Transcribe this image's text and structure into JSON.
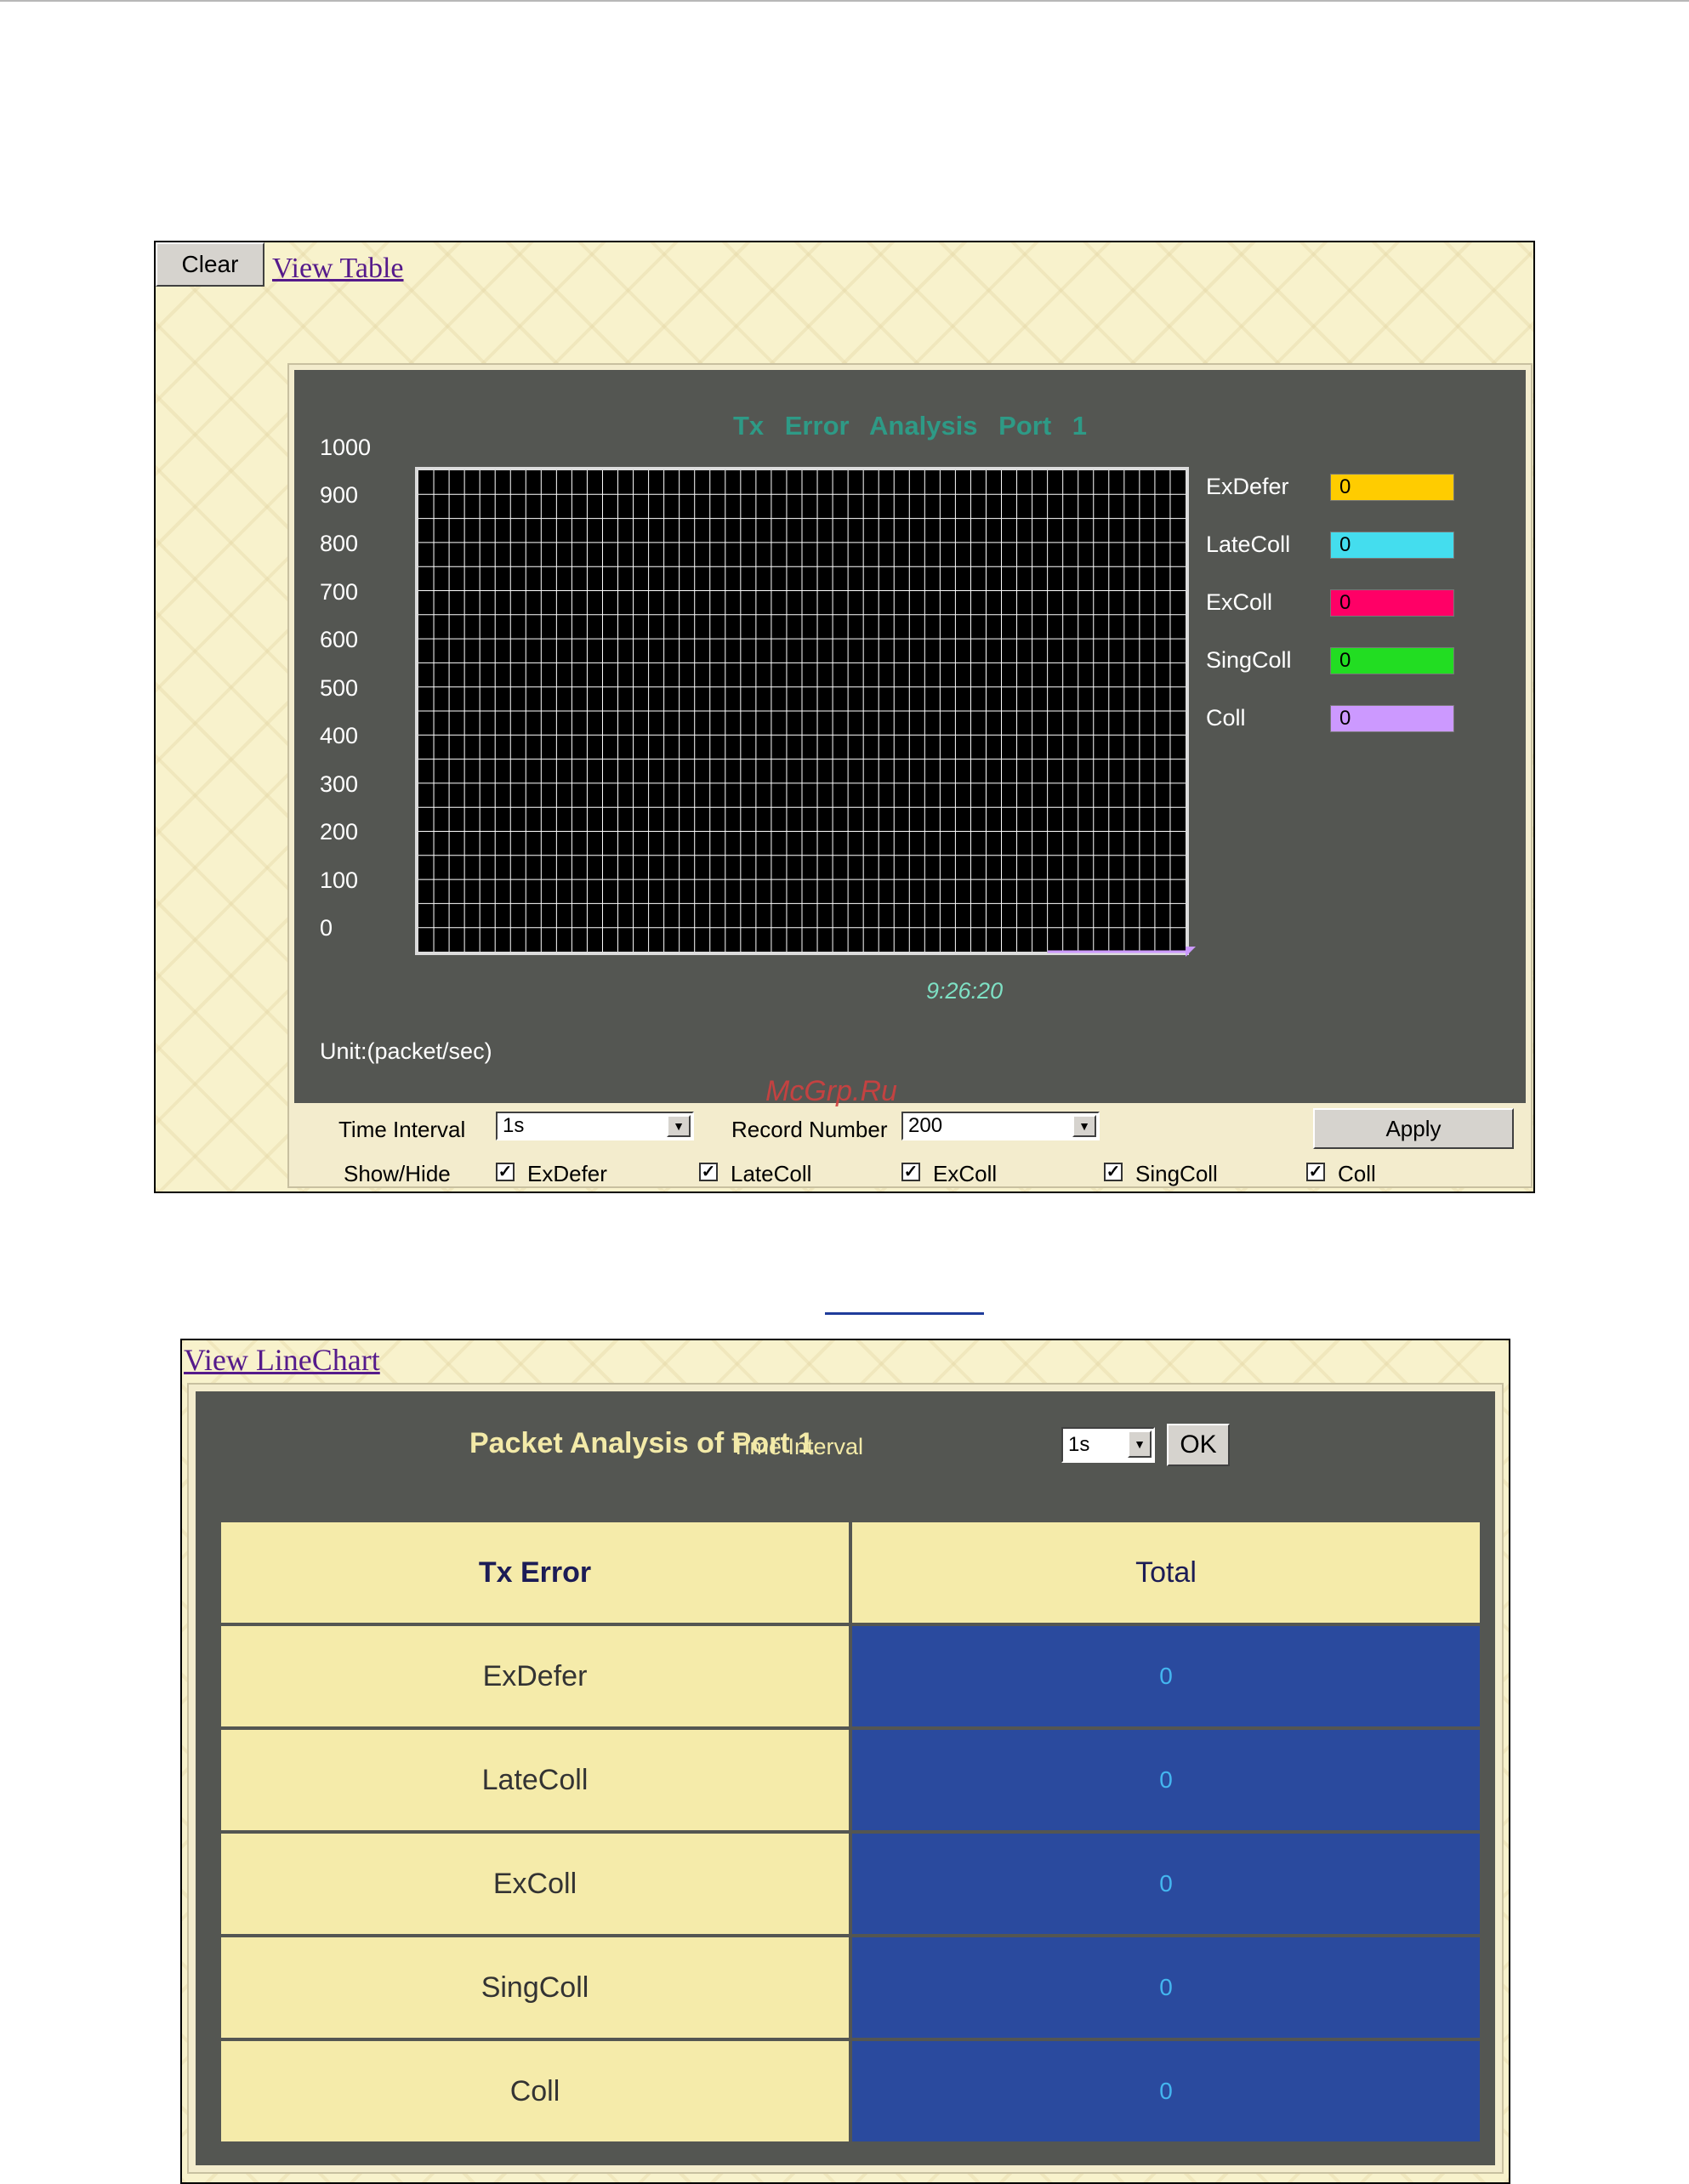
{
  "line_chart_panel": {
    "clear_label": "Clear",
    "view_table_label": "View Table",
    "title": "Tx Error Analysis   Port 1",
    "unit_label": "Unit:(packet/sec)",
    "time_label": "9:26:20",
    "legend": [
      {
        "label": "ExDefer",
        "value": "0",
        "color": "#ffcc00"
      },
      {
        "label": "LateColl",
        "value": "0",
        "color": "#44ddee"
      },
      {
        "label": "ExColl",
        "value": "0",
        "color": "#ff0066"
      },
      {
        "label": "SingColl",
        "value": "0",
        "color": "#22dd22"
      },
      {
        "label": "Coll",
        "value": "0",
        "color": "#cc99ff"
      }
    ],
    "controls": {
      "time_interval_label": "Time Interval",
      "time_interval_value": "1s",
      "record_number_label": "Record Number",
      "record_number_value": "200",
      "apply_label": "Apply",
      "show_hide_label": "Show/Hide",
      "checkboxes": [
        "ExDefer",
        "LateColl",
        "ExColl",
        "SingColl",
        "Coll"
      ],
      "checked_glyph": "✓"
    },
    "watermark": "McGrp.Ru"
  },
  "chart_data": {
    "type": "line",
    "title": "Tx Error Analysis   Port 1",
    "ylabel": "Unit:(packet/sec)",
    "ylim": [
      0,
      1000
    ],
    "yticks": [
      "1000",
      "900",
      "800",
      "700",
      "600",
      "500",
      "400",
      "300",
      "200",
      "100",
      "0"
    ],
    "x_marker_label": "9:26:20",
    "grid": true,
    "series": [
      {
        "name": "ExDefer",
        "values": [
          0
        ],
        "color": "#ffcc00"
      },
      {
        "name": "LateColl",
        "values": [
          0
        ],
        "color": "#44ddee"
      },
      {
        "name": "ExColl",
        "values": [
          0
        ],
        "color": "#ff0066"
      },
      {
        "name": "SingColl",
        "values": [
          0
        ],
        "color": "#22dd22"
      },
      {
        "name": "Coll",
        "values": [
          0
        ],
        "color": "#cc99ff"
      }
    ]
  },
  "table_panel": {
    "view_linechart_label": "View LineChart",
    "title": "Packet Analysis of Port 1",
    "time_interval_label": "Time Interval",
    "time_interval_value": "1s",
    "ok_label": "OK",
    "headers": [
      "Tx Error",
      "Total"
    ],
    "rows": [
      {
        "name": "ExDefer",
        "total": "0"
      },
      {
        "name": "LateColl",
        "total": "0"
      },
      {
        "name": "ExColl",
        "total": "0"
      },
      {
        "name": "SingColl",
        "total": "0"
      },
      {
        "name": "Coll",
        "total": "0"
      }
    ]
  }
}
